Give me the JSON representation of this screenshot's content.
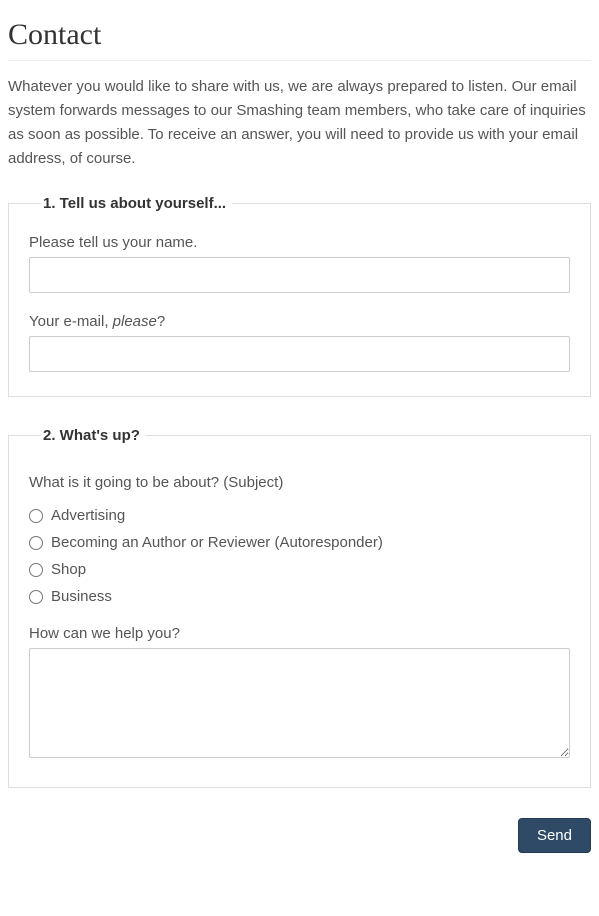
{
  "title": "Contact",
  "intro": "Whatever you would like to share with us, we are always prepared to listen. Our email system forwards messages to our Smashing team members, who take care of inquiries as soon as possible. To receive an answer, you will need to provide us with your email address, of course.",
  "section1": {
    "legend": "1. Tell us about yourself...",
    "name_label": "Please tell us your name.",
    "name_value": "",
    "email_label_pre": "Your e-mail, ",
    "email_label_em": "please",
    "email_label_post": "?",
    "email_value": ""
  },
  "section2": {
    "legend": "2. What's up?",
    "subject_label": "What is it going to be about? (Subject)",
    "options": {
      "0": "Advertising",
      "1": "Becoming an Author or Reviewer (Autoresponder)",
      "2": "Shop",
      "3": "Business"
    },
    "message_label": "How can we help you?",
    "message_value": ""
  },
  "submit_label": "Send"
}
